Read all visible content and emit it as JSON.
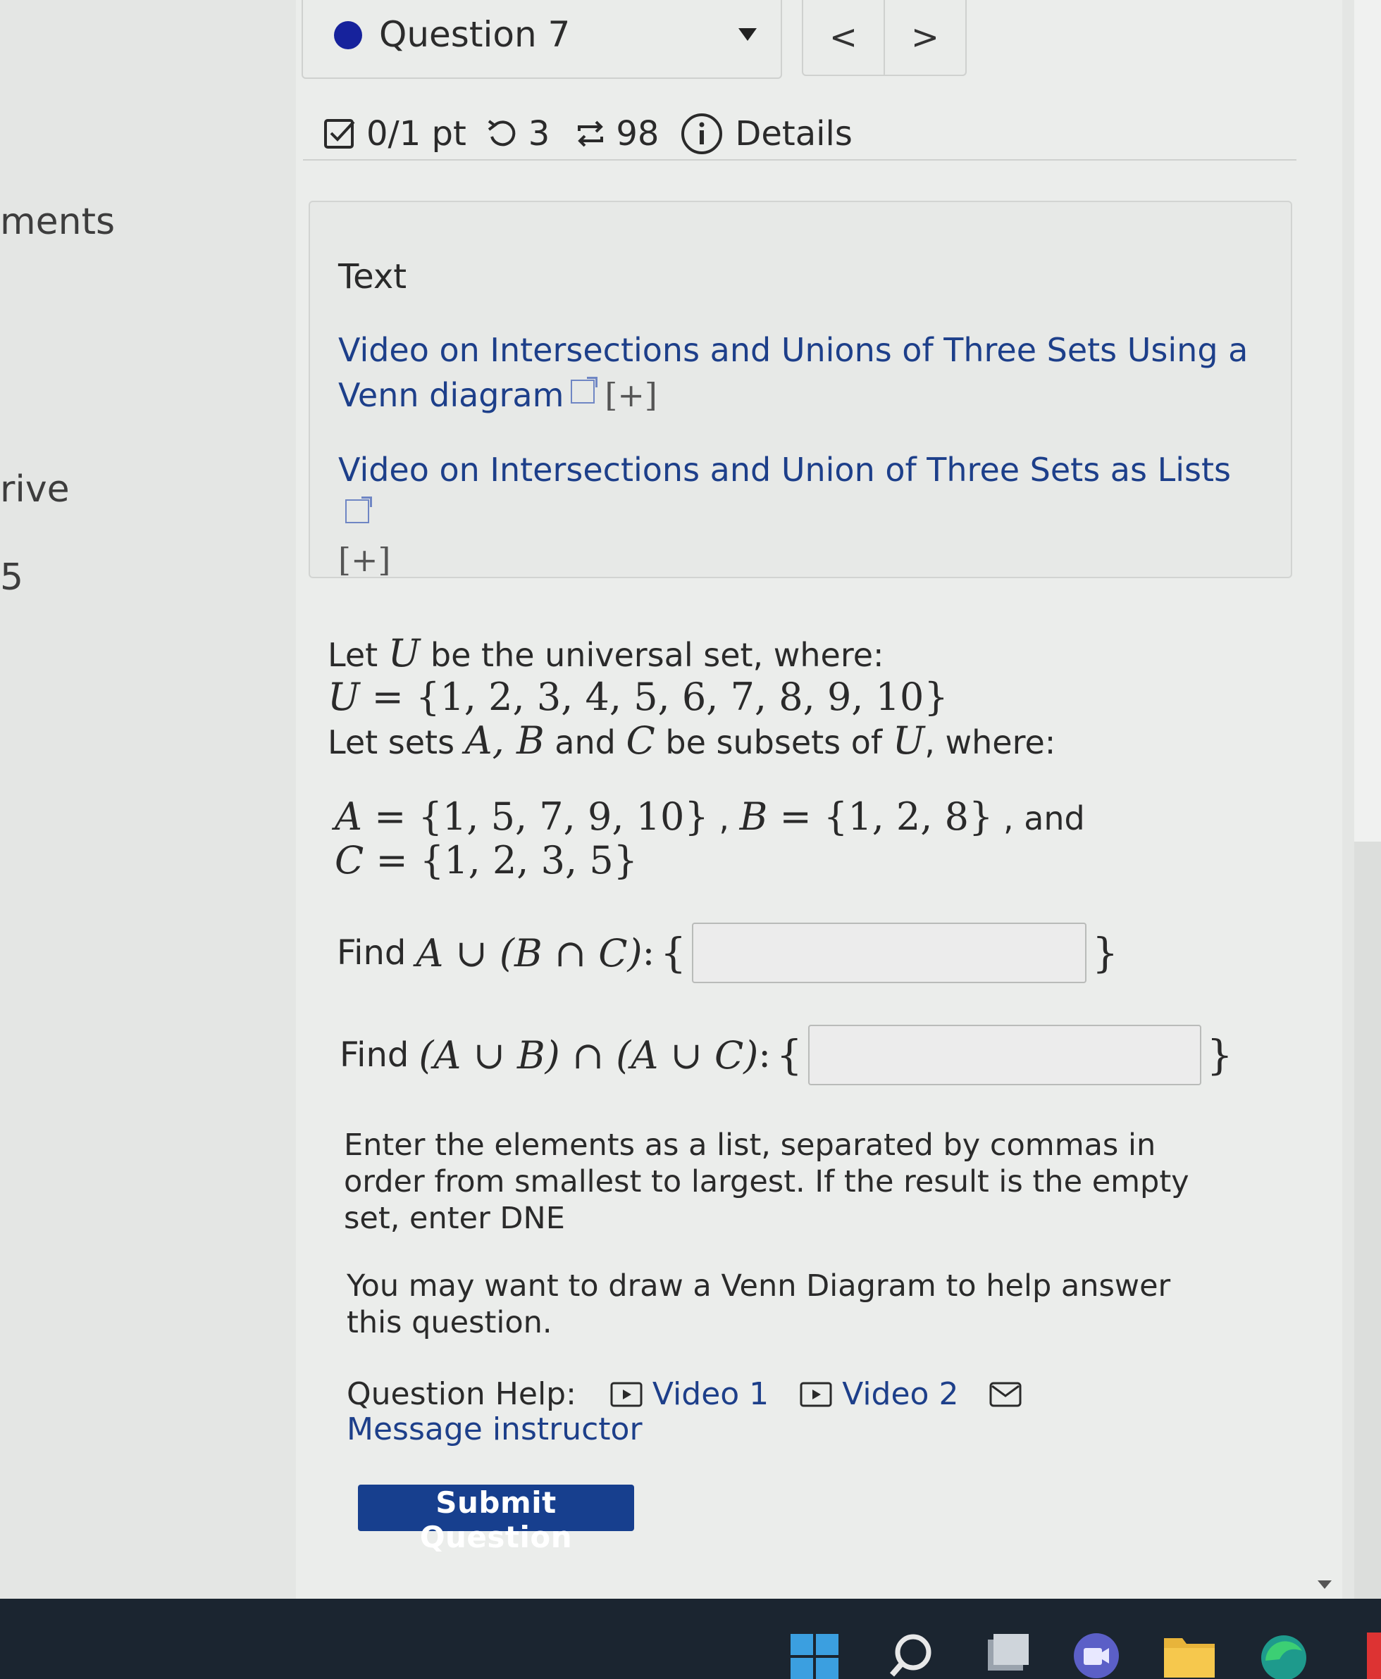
{
  "sidebar": {
    "fragments": [
      "ments",
      "rive",
      "5"
    ]
  },
  "question_selector": {
    "label": "Question 7",
    "prev": "<",
    "next": ">"
  },
  "status": {
    "score": "0/1 pt",
    "retries": "3",
    "attempts": "98",
    "details": "Details"
  },
  "resources": {
    "title": "Text",
    "link1": "Video on Intersections and Unions of Three Sets Using a Venn diagram",
    "link2": "Video on Intersections and Union of Three Sets as Lists",
    "expand": "[+]"
  },
  "problem": {
    "intro1_a": "Let ",
    "intro1_var": "U",
    "intro1_b": " be the universal set, where:",
    "universe_set": "{1, 2, 3, 4, 5, 6, 7, 8, 9, 10}",
    "intro2_a": "Let sets ",
    "intro2_vars": "A, B",
    "intro2_b": " and ",
    "intro2_var_c": "C",
    "intro2_c": " be subsets of ",
    "intro2_var_u": "U",
    "intro2_d": ", where:",
    "set_a": "{1, 5, 7, 9, 10}",
    "set_b": "{1, 2, 8}",
    "and_word": "and",
    "set_c": "{1, 2, 3, 5}",
    "find_word": "Find",
    "find1_expr": "A ∪ (B ∩ C)",
    "find2_expr": "(A ∪ B) ∩ (A ∪ C)",
    "answer1_value": "",
    "answer2_value": "",
    "instructions": "Enter the elements as a list, separated by commas in order from smallest to largest. If the result is the empty set, enter DNE",
    "hint": "You may want to draw a Venn Diagram to help answer this question."
  },
  "help": {
    "label": "Question Help:",
    "video1": "Video 1",
    "video2": "Video 2",
    "message": "Message instructor"
  },
  "submit_label": "Submit Question",
  "colors": {
    "accent": "#173f8e",
    "link": "#1d3f8a",
    "dot": "#16229c"
  }
}
